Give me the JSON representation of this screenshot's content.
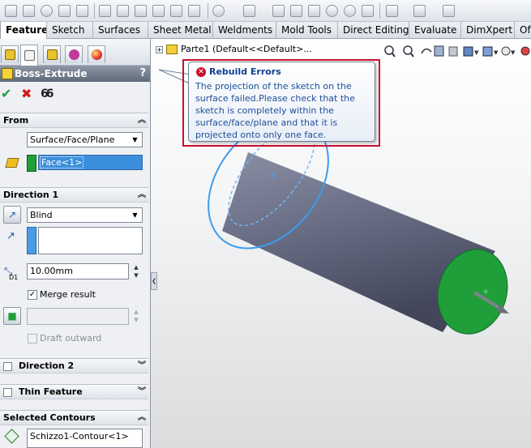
{
  "toolbar": {
    "icons": [
      "smart-dimension-icon",
      "sketch-icon",
      "rebuild-icon",
      "options-icon",
      "select-icon",
      "grid-icon",
      "measure-icon",
      "mass-properties-icon",
      "section-icon",
      "view-icon",
      "display-icon",
      "pattern-icon",
      "extrude-icon",
      "revolve-icon",
      "sweep-icon",
      "loft-icon",
      "fillet-icon",
      "curve-icon",
      "reference-icon"
    ]
  },
  "tabs": [
    {
      "label": "Features",
      "active": true
    },
    {
      "label": "Sketch"
    },
    {
      "label": "Surfaces"
    },
    {
      "label": "Sheet Metal"
    },
    {
      "label": "Weldments"
    },
    {
      "label": "Mold Tools"
    },
    {
      "label": "Direct Editing"
    },
    {
      "label": "Evaluate"
    },
    {
      "label": "DimXpert"
    },
    {
      "label": "Of"
    }
  ],
  "panel": {
    "title": "Boss-Extrude",
    "help": "?",
    "ok": "✔",
    "cancel": "✖",
    "preview": "66",
    "from": {
      "heading": "From",
      "start_condition": "Surface/Face/Plane",
      "selected_face": "Face<1>"
    },
    "direction1": {
      "heading": "Direction 1",
      "end_condition": "Blind",
      "depth": "10.00mm",
      "depth_icon_label": "D1",
      "merge_label": "Merge result",
      "merge_checked": true,
      "draft_label": "Draft outward"
    },
    "direction2": {
      "heading": "Direction 2"
    },
    "thin_feature": {
      "heading": "Thin Feature"
    },
    "selected_contours": {
      "heading": "Selected Contours",
      "item": "Schizzo1-Contour<1>"
    }
  },
  "view": {
    "part_name": "Parte1  (Default<<Default>...",
    "tooltip": {
      "title": "Rebuild Errors",
      "body": "The projection of the sketch on the surface failed.Please check that the sketch is completely within the surface/face/plane and that it is projected onto only one face."
    }
  },
  "colors": {
    "error_red": "#c8102e",
    "tooltip_text": "#1e4f9a",
    "selection_green": "#1f9e3a",
    "selection_blue": "#3c8fdc",
    "sketch_blue": "#3b9cf0"
  }
}
